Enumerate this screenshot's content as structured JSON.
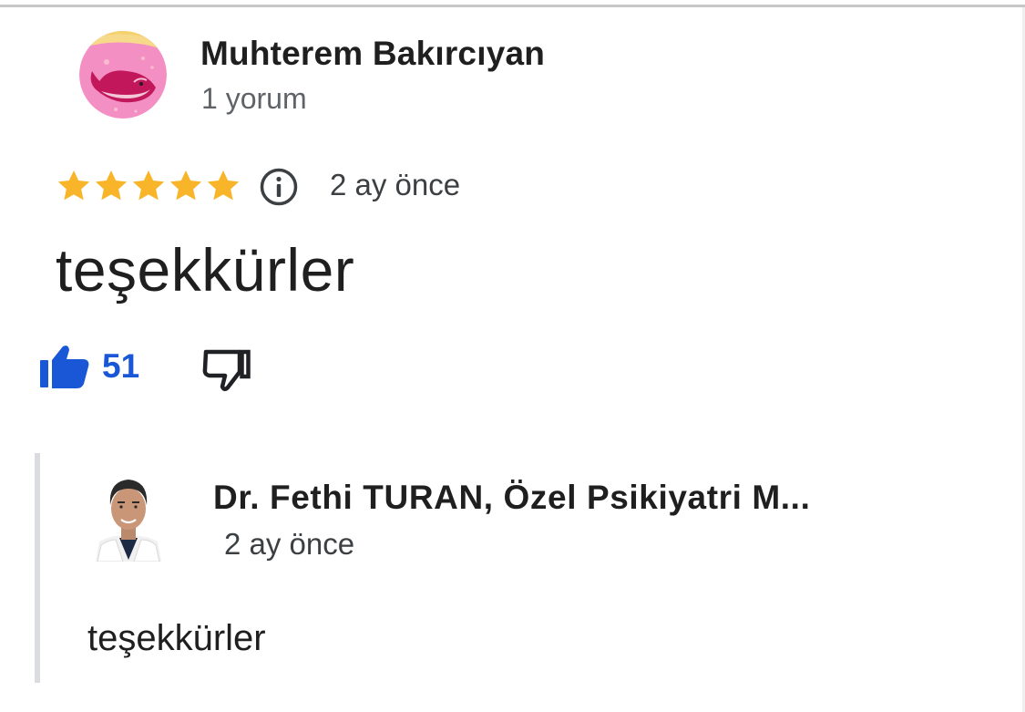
{
  "review": {
    "reviewer_name": "Muhterem Bakırcıyan",
    "reviewer_meta": "1 yorum",
    "rating": 5,
    "max_rating": 5,
    "date": "2 ay önce",
    "text": "teşekkürler",
    "like_count": "51"
  },
  "reply": {
    "owner_name": "Dr. Fethi TURAN, Özel Psikiyatri M...",
    "date": "2 ay önce",
    "text": "teşekkürler"
  },
  "icons": {
    "info": "info-icon",
    "like": "thumbs-up-icon",
    "dislike": "thumbs-down-icon",
    "star": "star-icon"
  },
  "colors": {
    "star": "#f9b52a",
    "like_accent": "#1a57d6",
    "secondary_text": "#5f6368",
    "avatar_bg": "#f48fc4",
    "reply_bar": "#dadce0"
  }
}
